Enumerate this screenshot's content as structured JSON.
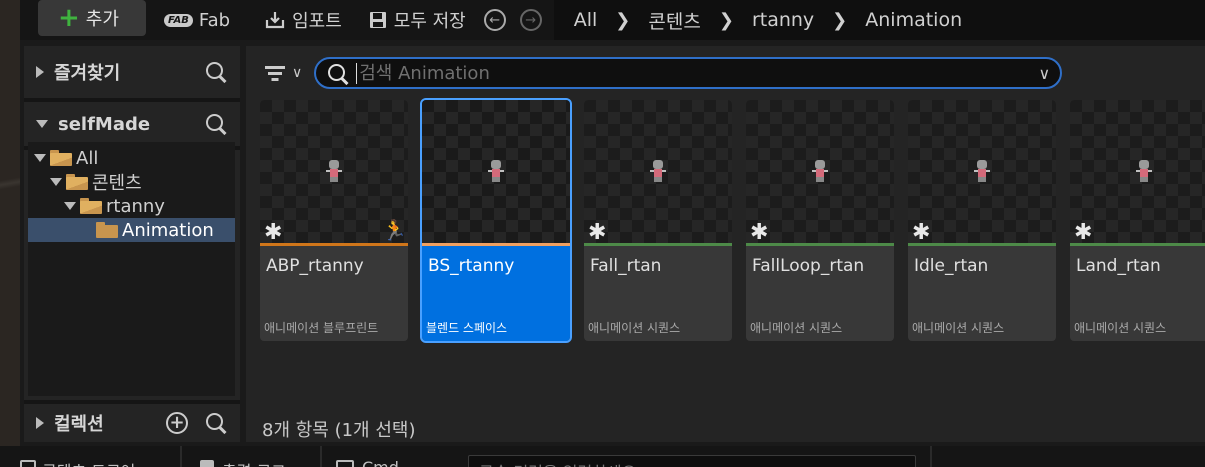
{
  "toolbar": {
    "add_label": "추가",
    "fab_logo": "FAB",
    "fab_label": "Fab",
    "import_label": "임포트",
    "save_all_label": "모두 저장"
  },
  "breadcrumb": [
    "All",
    "콘텐츠",
    "rtanny",
    "Animation"
  ],
  "sidebar": {
    "favorites_label": "즐겨찾기",
    "project_label": "selfMade",
    "tree": [
      {
        "label": "All"
      },
      {
        "label": "콘텐츠"
      },
      {
        "label": "rtanny"
      },
      {
        "label": "Animation"
      }
    ],
    "collections_label": "컬렉션"
  },
  "search": {
    "placeholder": "검색 Animation"
  },
  "assets": [
    {
      "name": "ABP_rtanny",
      "type": "애니메이션 블루프린트",
      "bar_color": "#d0761a",
      "selected": false
    },
    {
      "name": "BS_rtanny",
      "type": "블렌드 스페이스",
      "bar_color": "#f0a060",
      "selected": true
    },
    {
      "name": "Fall_rtan",
      "type": "애니메이션 시퀀스",
      "bar_color": "#4d8a48",
      "selected": false
    },
    {
      "name": "FallLoop_rtan",
      "type": "애니메이션 시퀀스",
      "bar_color": "#4d8a48",
      "selected": false
    },
    {
      "name": "Idle_rtan",
      "type": "애니메이션 시퀀스",
      "bar_color": "#4d8a48",
      "selected": false
    },
    {
      "name": "Land_rtan",
      "type": "애니메이션 시퀀스",
      "bar_color": "#4d8a48",
      "selected": false
    }
  ],
  "status_text": "8개 항목 (1개 선택)",
  "bottom_bar": {
    "content_drawer": "콘텐츠 드로어",
    "output_log": "출력 로그",
    "cmd": "Cmd",
    "console_placeholder": "콘솔 명령을 입력하세요"
  },
  "colors": {
    "accent": "#0070e0",
    "search_border": "#2f6fc8",
    "add_icon": "#3fb33f",
    "folder": "#c8954e",
    "tree_selected": "#3a4f6b"
  }
}
